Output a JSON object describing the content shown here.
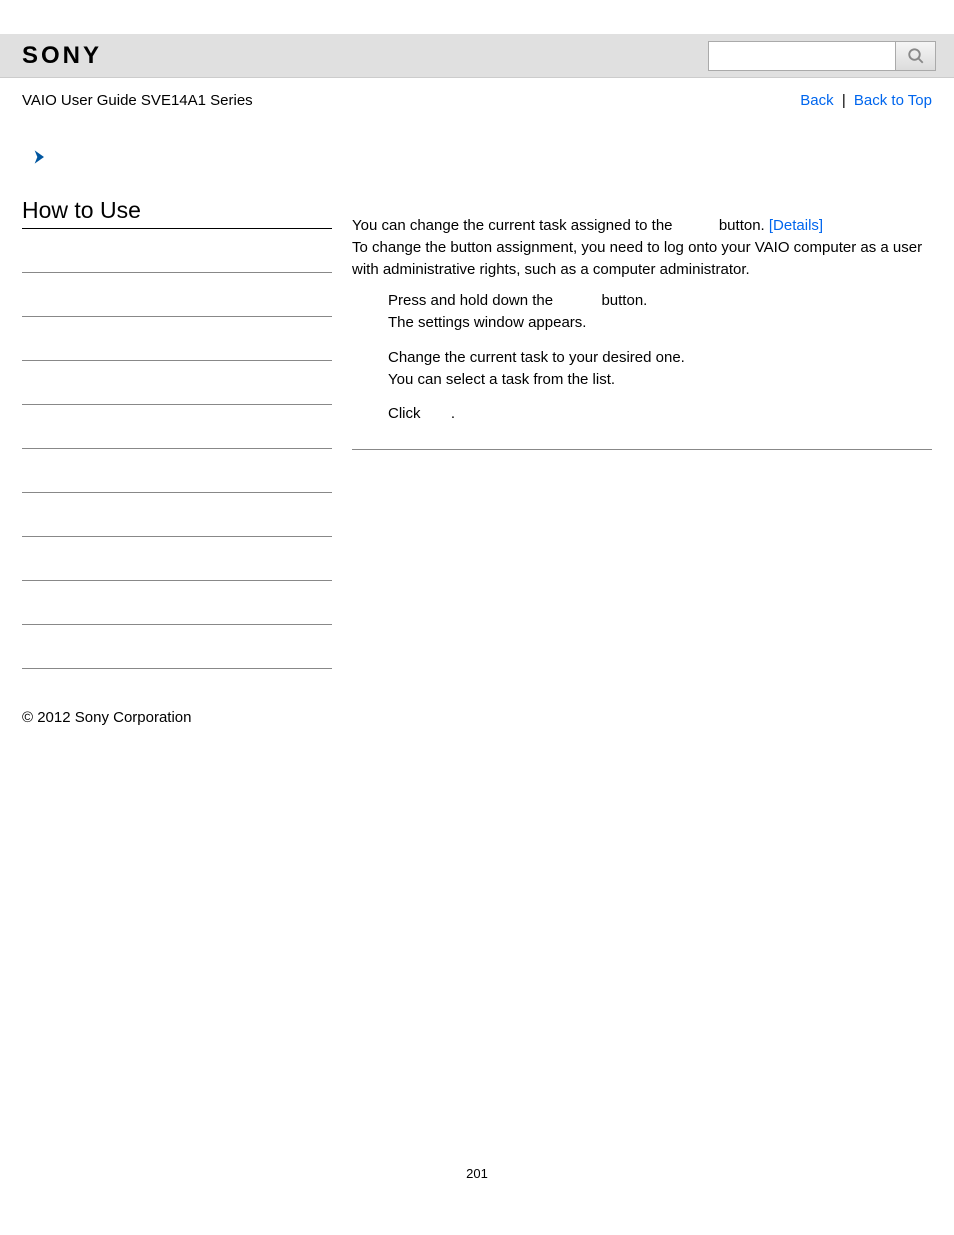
{
  "header": {
    "brand": "SONY",
    "search_placeholder": ""
  },
  "subheader": {
    "guide_title": "VAIO User Guide SVE14A1 Series",
    "back_label": "Back",
    "separator": "|",
    "back_to_top_label": "Back to Top"
  },
  "sidebar": {
    "title": "How to Use",
    "empty_rows": 10
  },
  "main": {
    "intro_line1_a": "You can change the current task assigned to the ",
    "intro_line1_b": " button. ",
    "details_link": "[Details]",
    "intro_line2": "To change the button assignment, you need to log onto your VAIO computer as a user with administrative rights, such as a computer administrator.",
    "steps": [
      {
        "line1_a": "Press and hold down the ",
        "line1_b": " button.",
        "line2": "The settings window appears."
      },
      {
        "line1": "Change the current task to your desired one.",
        "line2": "You can select a task from the list."
      },
      {
        "line1_a": "Click ",
        "line1_b": " ."
      }
    ]
  },
  "footer": {
    "copyright": "© 2012 Sony Corporation",
    "page_number": "201"
  }
}
